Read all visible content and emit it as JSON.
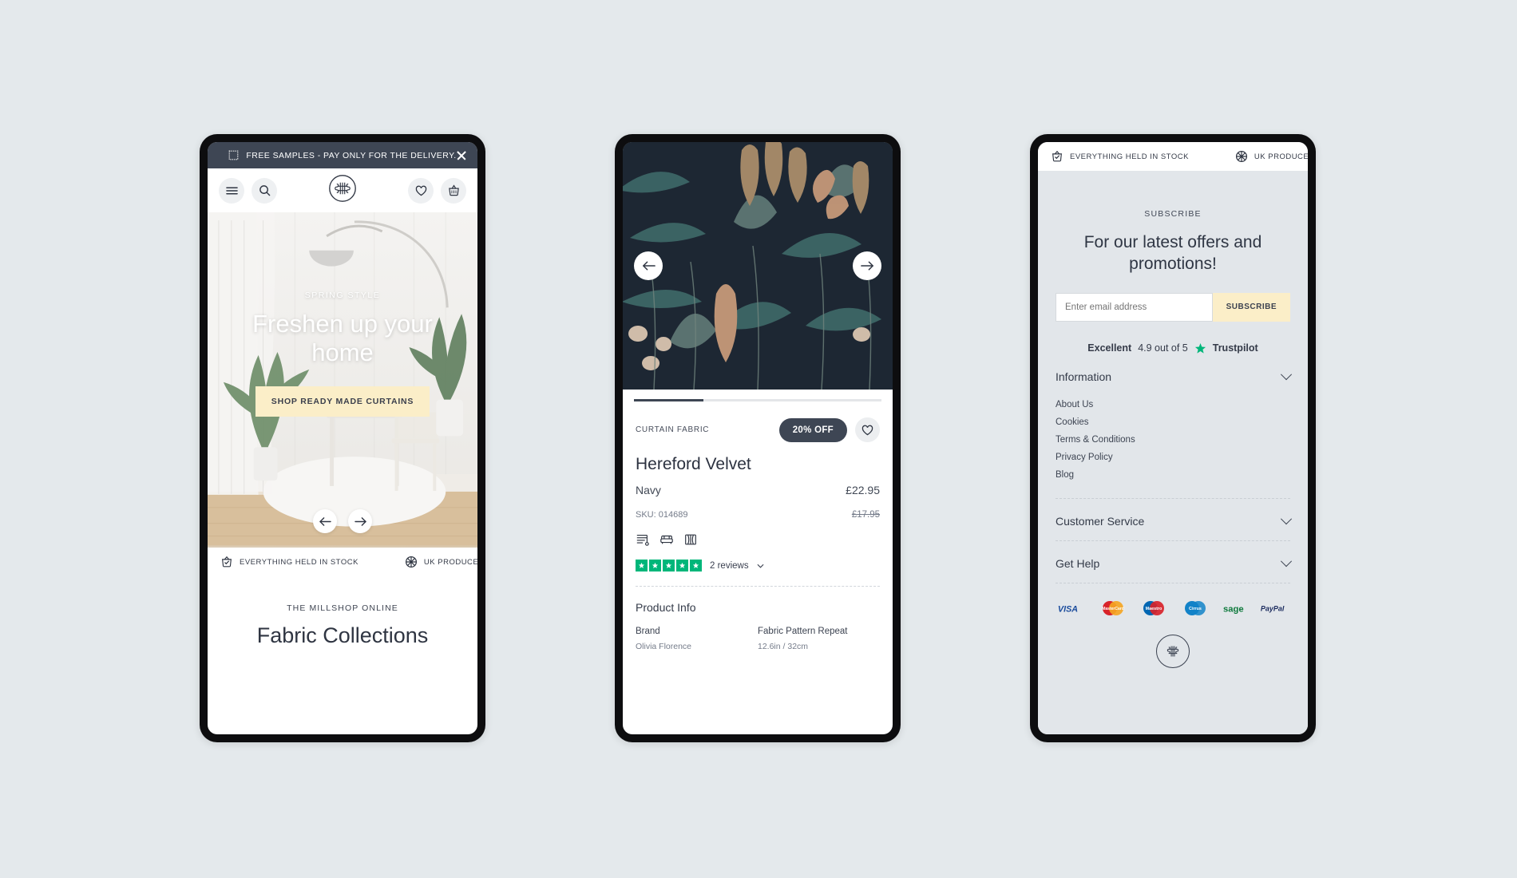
{
  "canvas": {
    "background": "#e4e9ec"
  },
  "colors": {
    "dark": "#3e4654",
    "cream": "#fbeec8",
    "footer_bg": "#e2e6ea",
    "trustpilot_green": "#00b67a"
  },
  "phone1": {
    "promo": {
      "icon": "sample-swatch-icon",
      "text": "FREE SAMPLES - PAY ONLY FOR THE DELIVERY.",
      "close_icon": "close-icon"
    },
    "nav": {
      "menu_icon": "hamburger-menu-icon",
      "search_icon": "search-icon",
      "logo_icon": "millshop-monogram-icon",
      "wishlist_icon": "heart-icon",
      "basket_icon": "basket-icon"
    },
    "hero": {
      "eyebrow": "SPRING STYLE",
      "title": "Freshen up your home",
      "cta": "SHOP READY MADE CURTAINS",
      "prev_icon": "arrow-left-icon",
      "next_icon": "arrow-right-icon"
    },
    "trustbar": [
      {
        "icon": "stock-basket-check-icon",
        "label": "EVERYTHING HELD IN STOCK"
      },
      {
        "icon": "uk-globe-icon",
        "label": "UK PRODUCED PR"
      }
    ],
    "collections": {
      "eyebrow": "THE MILLSHOP ONLINE",
      "title": "Fabric Collections"
    }
  },
  "phone2": {
    "gallery": {
      "prev_icon": "arrow-left-icon",
      "next_icon": "arrow-right-icon",
      "image_alt": "dark-botanical-fabric-swatch"
    },
    "product": {
      "kicker": "CURTAIN FABRIC",
      "badge": "20% OFF",
      "fav_icon": "heart-icon",
      "name": "Hereford Velvet",
      "colour": "Navy",
      "price": "£22.95",
      "sku": "SKU: 014689",
      "was_price": "£17.95",
      "usage_icons": [
        "blinds-icon",
        "upholstery-sofa-icon",
        "curtains-icon"
      ],
      "rating_stars": 5,
      "reviews_text": "2 reviews",
      "reviews_chevron": "chevron-down-icon"
    },
    "info": {
      "title": "Product Info",
      "specs": [
        {
          "key": "Brand",
          "value": "Olivia Florence"
        },
        {
          "key": "Fabric Pattern Repeat",
          "value": "12.6in / 32cm"
        }
      ]
    }
  },
  "phone3": {
    "trustbar": [
      {
        "icon": "stock-basket-check-icon",
        "label": "EVERYTHING HELD IN STOCK"
      },
      {
        "icon": "uk-globe-icon",
        "label": "UK PRODUCED PR"
      }
    ],
    "subscribe": {
      "kicker": "SUBSCRIBE",
      "heading": "For our latest offers and promotions!",
      "placeholder": "Enter email address",
      "button": "SUBSCRIBE"
    },
    "trustpilot": {
      "excellent": "Excellent",
      "score": "4.9 out of 5",
      "star_icon": "star-icon",
      "name": "Trustpilot"
    },
    "accordions": [
      {
        "title": "Information",
        "chevron": "chevron-down-icon",
        "expanded": true,
        "links": [
          "About Us",
          "Cookies",
          "Terms & Conditions",
          "Privacy Policy",
          "Blog"
        ]
      },
      {
        "title": "Customer Service",
        "chevron": "chevron-down-icon",
        "expanded": false,
        "links": []
      },
      {
        "title": "Get Help",
        "chevron": "chevron-down-icon",
        "expanded": false,
        "links": []
      }
    ],
    "payments": [
      {
        "name": "VISA",
        "icon": "visa-icon",
        "color": "#1a4b9c"
      },
      {
        "name": "MasterCard",
        "icon": "mastercard-icon",
        "color": "#d8232a"
      },
      {
        "name": "Maestro",
        "icon": "maestro-icon",
        "color": "#0066b2"
      },
      {
        "name": "Cirrus",
        "icon": "cirrus-icon",
        "color": "#1282c8"
      },
      {
        "name": "sage",
        "icon": "sage-icon",
        "color": "#0f7a3d"
      },
      {
        "name": "PayPal",
        "icon": "paypal-icon",
        "color": "#1b2b5e"
      }
    ],
    "footer_logo_icon": "millshop-monogram-icon"
  }
}
